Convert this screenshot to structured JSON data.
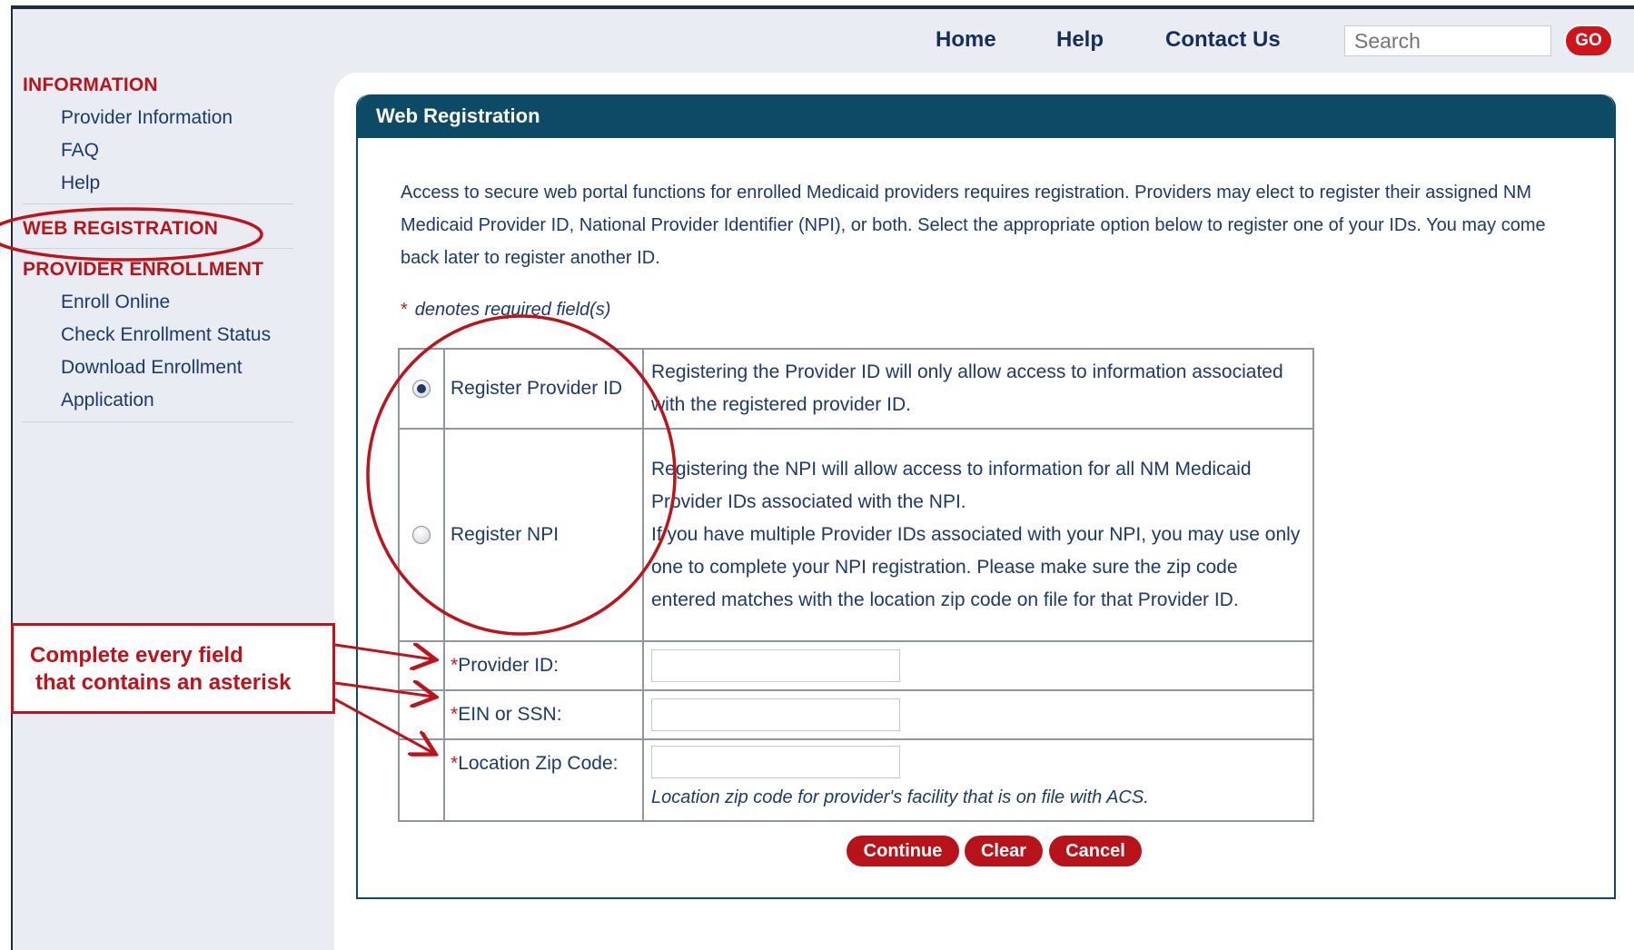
{
  "topnav": {
    "home": "Home",
    "help": "Help",
    "contact": "Contact Us",
    "search_placeholder": "Search",
    "go": "GO"
  },
  "sidebar": {
    "information_heading": "INFORMATION",
    "information_items": [
      "Provider Information",
      "FAQ",
      "Help"
    ],
    "web_registration": "WEB REGISTRATION",
    "enrollment_heading": "PROVIDER ENROLLMENT",
    "enrollment_items": [
      "Enroll Online",
      "Check Enrollment Status",
      "Download Enrollment",
      "Application"
    ]
  },
  "panel": {
    "title": "Web Registration",
    "intro": "Access to secure web portal functions for enrolled Medicaid providers requires registration. Providers may elect to register their assigned NM Medicaid Provider ID, National Provider Identifier (NPI), or both. Select the appropriate option below to register one of your IDs. You may come back later to register another ID.",
    "required_asterisk": "*",
    "required_note": "denotes required field(s)"
  },
  "options": {
    "provider_id_label": "Register Provider ID",
    "provider_id_desc": "Registering the Provider ID will only allow access to information associated with the registered provider ID.",
    "npi_label": "Register NPI",
    "npi_desc_1": "Registering the NPI will allow access to information for all NM Medicaid Provider IDs associated with the NPI.",
    "npi_desc_2": "If you have multiple Provider IDs associated with your NPI, you may use only one to complete your NPI registration. Please make sure the zip code entered matches with the location zip code on file for that Provider ID."
  },
  "fields": {
    "asterisk": "*",
    "provider_id": "Provider ID:",
    "ein_ssn": "EIN or SSN:",
    "zip": "Location Zip Code:",
    "zip_hint": "Location zip code for provider's facility that is on file with ACS."
  },
  "buttons": {
    "continue": "Continue",
    "clear": "Clear",
    "cancel": "Cancel"
  },
  "annotation": {
    "line1": "Complete every field",
    "line2": "that contains an asterisk"
  },
  "colors": {
    "brand_red": "#b5161b",
    "header_blue": "#0d4a66",
    "annotation_red": "#c0121a"
  }
}
